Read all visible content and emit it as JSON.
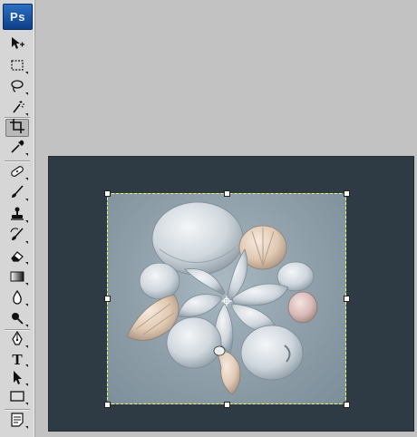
{
  "app": {
    "logo_text": "Ps",
    "brand_color": "#1c56a8"
  },
  "toolbar": {
    "tools": [
      {
        "name": "move-tool",
        "icon": "move-icon"
      },
      {
        "name": "rectangular-marquee-tool",
        "icon": "marquee-icon"
      },
      {
        "name": "lasso-tool",
        "icon": "lasso-icon"
      },
      {
        "name": "magic-wand-tool",
        "icon": "magic-wand-icon"
      },
      {
        "name": "crop-tool",
        "icon": "crop-icon",
        "active": true
      },
      {
        "name": "eyedropper-tool",
        "icon": "eyedropper-icon"
      },
      {
        "name": "healing-brush-tool",
        "icon": "bandage-icon"
      },
      {
        "name": "brush-tool",
        "icon": "brush-icon"
      },
      {
        "name": "clone-stamp-tool",
        "icon": "stamp-icon"
      },
      {
        "name": "history-brush-tool",
        "icon": "history-brush-icon"
      },
      {
        "name": "eraser-tool",
        "icon": "eraser-icon"
      },
      {
        "name": "gradient-tool",
        "icon": "gradient-icon"
      },
      {
        "name": "blur-tool",
        "icon": "drop-icon"
      },
      {
        "name": "dodge-tool",
        "icon": "dodge-icon"
      },
      {
        "name": "pen-tool",
        "icon": "pen-icon"
      },
      {
        "name": "type-tool",
        "icon": "type-icon",
        "label": "T"
      },
      {
        "name": "path-selection-tool",
        "icon": "arrow-icon"
      },
      {
        "name": "shape-tool",
        "icon": "rectangle-icon"
      },
      {
        "name": "notes-tool",
        "icon": "note-icon"
      }
    ]
  },
  "canvas": {
    "background_color": "#2f3b44",
    "crop_outer_color": "#ff3344",
    "crop_inner_color": "#e8ff6a"
  }
}
